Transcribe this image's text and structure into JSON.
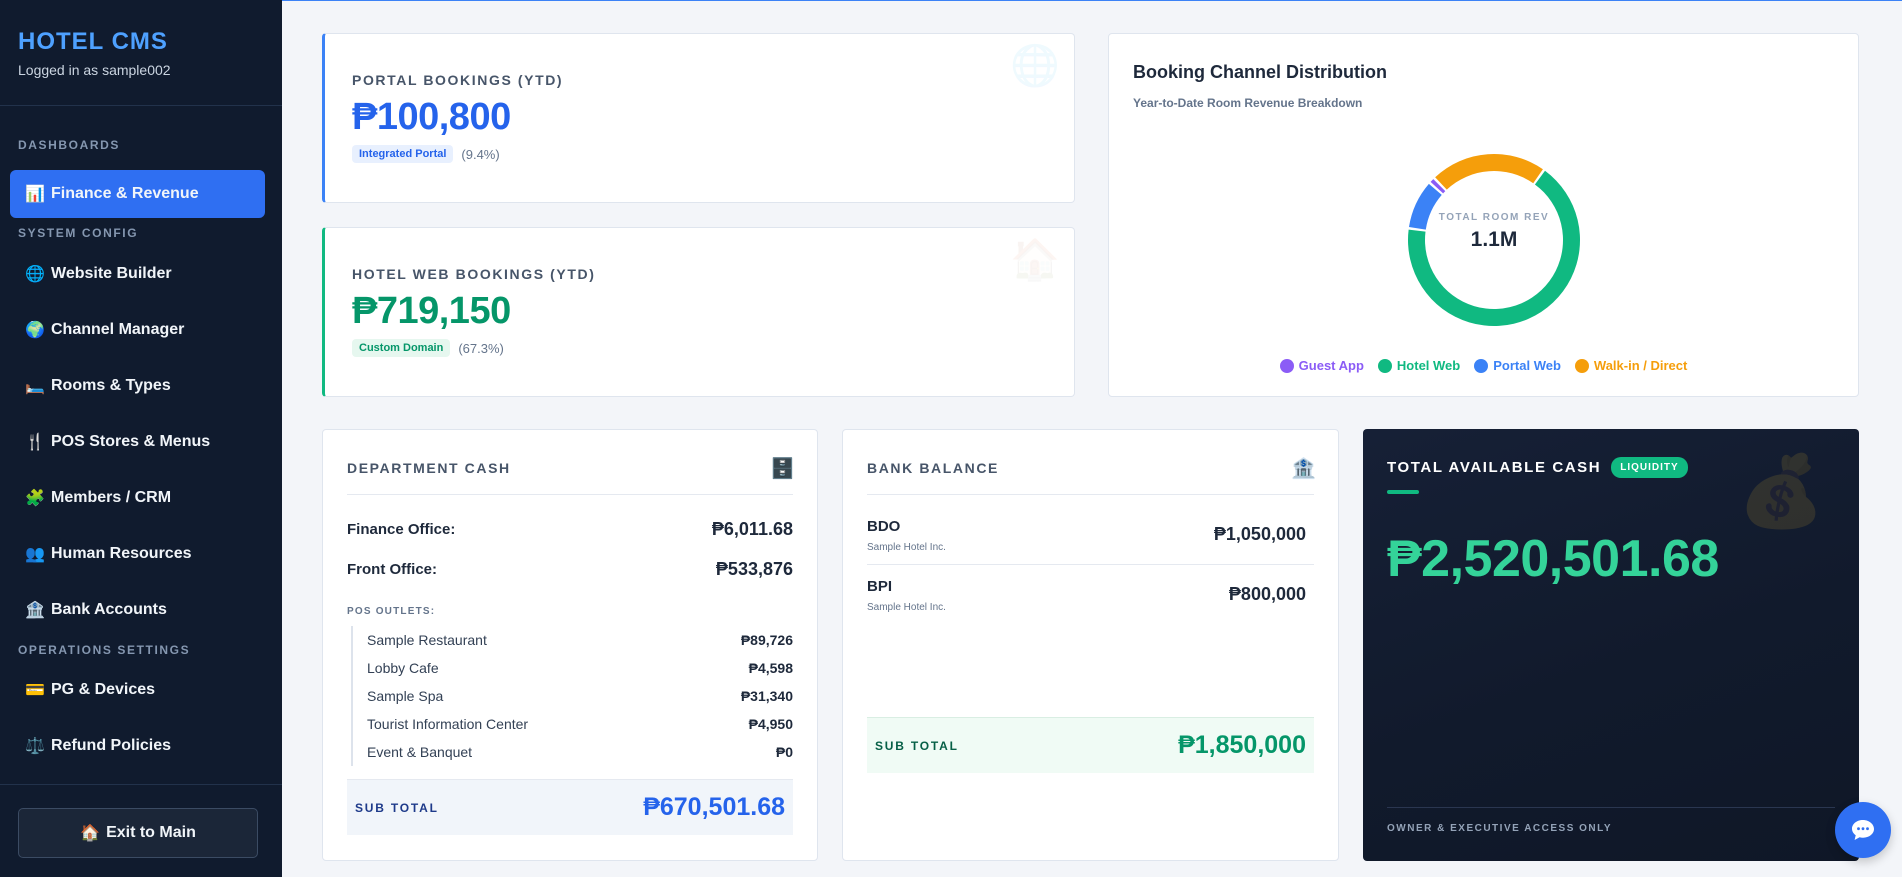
{
  "sidebar": {
    "title": "HOTEL CMS",
    "subtitle": "Logged in as sample002",
    "sections": {
      "dashboards": "DASHBOARDS",
      "system_config": "SYSTEM CONFIG",
      "operations_settings": "OPERATIONS SETTINGS"
    },
    "items": [
      {
        "icon": "📊",
        "icon_name": "bar-chart-icon",
        "label": "Finance & Revenue",
        "active": true
      },
      {
        "icon": "🌐",
        "icon_name": "globe-icon",
        "label": "Website Builder"
      },
      {
        "icon": "🌍",
        "icon_name": "earth-icon",
        "label": "Channel Manager"
      },
      {
        "icon": "🛏️",
        "icon_name": "bed-icon",
        "label": "Rooms & Types"
      },
      {
        "icon": "🍴",
        "icon_name": "cutlery-icon",
        "label": "POS Stores & Menus"
      },
      {
        "icon": "🧩",
        "icon_name": "puzzle-icon",
        "label": "Members / CRM"
      },
      {
        "icon": "👥",
        "icon_name": "people-icon",
        "label": "Human Resources"
      },
      {
        "icon": "🏦",
        "icon_name": "bank-icon",
        "label": "Bank Accounts"
      },
      {
        "icon": "💳",
        "icon_name": "credit-card-icon",
        "label": "PG & Devices"
      },
      {
        "icon": "⚖️",
        "icon_name": "scales-icon",
        "label": "Refund Policies"
      }
    ],
    "exit": {
      "icon": "🏠",
      "label": "Exit to Main"
    }
  },
  "portal": {
    "label": "PORTAL BOOKINGS (YTD)",
    "value": "₱100,800",
    "badge": "Integrated Portal",
    "pct": "(9.4%)",
    "color": "#2563eb",
    "badge_bg": "#e8f0fe"
  },
  "hotelweb": {
    "label": "HOTEL WEB BOOKINGS (YTD)",
    "value": "₱719,150",
    "badge": "Custom Domain",
    "pct": "(67.3%)",
    "color": "#059669",
    "badge_bg": "#e6f7ef"
  },
  "chart": {
    "title": "Booking Channel Distribution",
    "subtitle": "Year-to-Date Room Revenue Breakdown",
    "center_label": "TOTAL ROOM REV",
    "center_value": "1.1M"
  },
  "chart_data": {
    "type": "pie",
    "categories": [
      "Guest App",
      "Hotel Web",
      "Portal Web",
      "Walk-in / Direct"
    ],
    "values": [
      1.2,
      67.3,
      9.4,
      22.1
    ],
    "colors": [
      "#8b5cf6",
      "#10b981",
      "#3b82f6",
      "#f59e0b"
    ],
    "draw_order": [
      1,
      2,
      0,
      3
    ],
    "legend_position": "bottom"
  },
  "dept": {
    "header": "DEPARTMENT CASH",
    "icon": "🗄️",
    "rows": [
      {
        "label": "Finance Office:",
        "value": "₱6,011.68"
      },
      {
        "label": "Front Office:",
        "value": "₱533,876"
      }
    ],
    "pos_header": "POS OUTLETS:",
    "pos": [
      {
        "label": "Sample Restaurant",
        "value": "₱89,726"
      },
      {
        "label": "Lobby Cafe",
        "value": "₱4,598"
      },
      {
        "label": "Sample Spa",
        "value": "₱31,340"
      },
      {
        "label": "Tourist Information Center",
        "value": "₱4,950"
      },
      {
        "label": "Event & Banquet",
        "value": "₱0"
      }
    ],
    "subtotal_label": "SUB TOTAL",
    "subtotal_value": "₱670,501.68"
  },
  "bank": {
    "header": "BANK BALANCE",
    "icon": "🏦",
    "rows": [
      {
        "name": "BDO",
        "owner": "Sample Hotel Inc.",
        "value": "₱1,050,000"
      },
      {
        "name": "BPI",
        "owner": "Sample Hotel Inc.",
        "value": "₱800,000"
      }
    ],
    "subtotal_label": "SUB TOTAL",
    "subtotal_value": "₱1,850,000"
  },
  "total": {
    "title": "TOTAL AVAILABLE CASH",
    "badge": "LIQUIDITY",
    "value": "₱2,520,501.68",
    "footer": "OWNER & EXECUTIVE ACCESS ONLY",
    "icon": "💰"
  }
}
